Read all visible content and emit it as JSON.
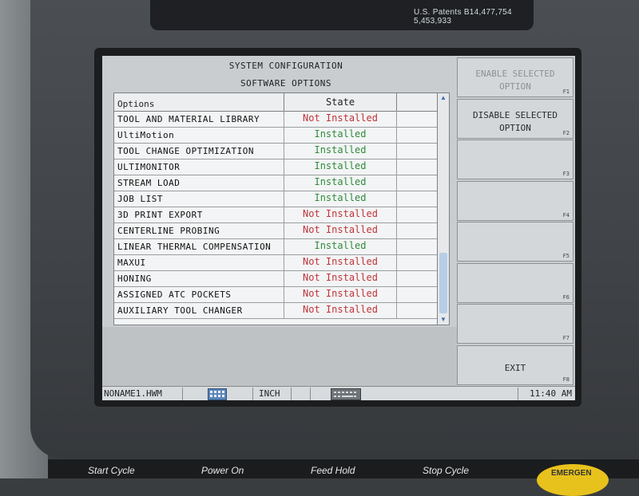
{
  "machine": {
    "patents": "U.S. Patents B14,477,754 5,453,933"
  },
  "screen": {
    "title": "SYSTEM CONFIGURATION",
    "subtitle": "SOFTWARE OPTIONS"
  },
  "table": {
    "headers": {
      "options": "Options",
      "state": "State"
    },
    "rows": [
      {
        "name": "TOOL AND MATERIAL LIBRARY",
        "state": "Not Installed"
      },
      {
        "name": "UltiMotion",
        "state": "Installed"
      },
      {
        "name": "TOOL CHANGE OPTIMIZATION",
        "state": "Installed"
      },
      {
        "name": "ULTIMONITOR",
        "state": "Installed"
      },
      {
        "name": "STREAM LOAD",
        "state": "Installed"
      },
      {
        "name": "JOB LIST",
        "state": "Installed"
      },
      {
        "name": "3D PRINT EXPORT",
        "state": "Not Installed"
      },
      {
        "name": "CENTERLINE PROBING",
        "state": "Not Installed"
      },
      {
        "name": "LINEAR THERMAL COMPENSATION",
        "state": "Installed"
      },
      {
        "name": "MAXUI",
        "state": "Not Installed"
      },
      {
        "name": "HONING",
        "state": "Not Installed"
      },
      {
        "name": "ASSIGNED ATC POCKETS",
        "state": "Not Installed"
      },
      {
        "name": "AUXILIARY TOOL CHANGER",
        "state": "Not Installed"
      }
    ]
  },
  "fkeys": [
    {
      "label": "ENABLE SELECTED OPTION",
      "key": "F1"
    },
    {
      "label": "DISABLE SELECTED OPTION",
      "key": "F2"
    },
    {
      "label": "",
      "key": "F3"
    },
    {
      "label": "",
      "key": "F4"
    },
    {
      "label": "",
      "key": "F5"
    },
    {
      "label": "",
      "key": "F6"
    },
    {
      "label": "",
      "key": "F7"
    },
    {
      "label": "EXIT",
      "key": "F8"
    }
  ],
  "status_bar": {
    "file": "NONAME1.HWM",
    "units": "INCH",
    "time": "11:40 AM"
  },
  "controls": {
    "start_cycle": "Start Cycle",
    "power_on": "Power On",
    "feed_hold": "Feed Hold",
    "stop_cycle": "Stop Cycle",
    "emergency": "EMERGEN"
  },
  "colors": {
    "not_installed": "#c0343a",
    "installed": "#2e8b3b",
    "screen_bg": "#c9cdd0"
  }
}
